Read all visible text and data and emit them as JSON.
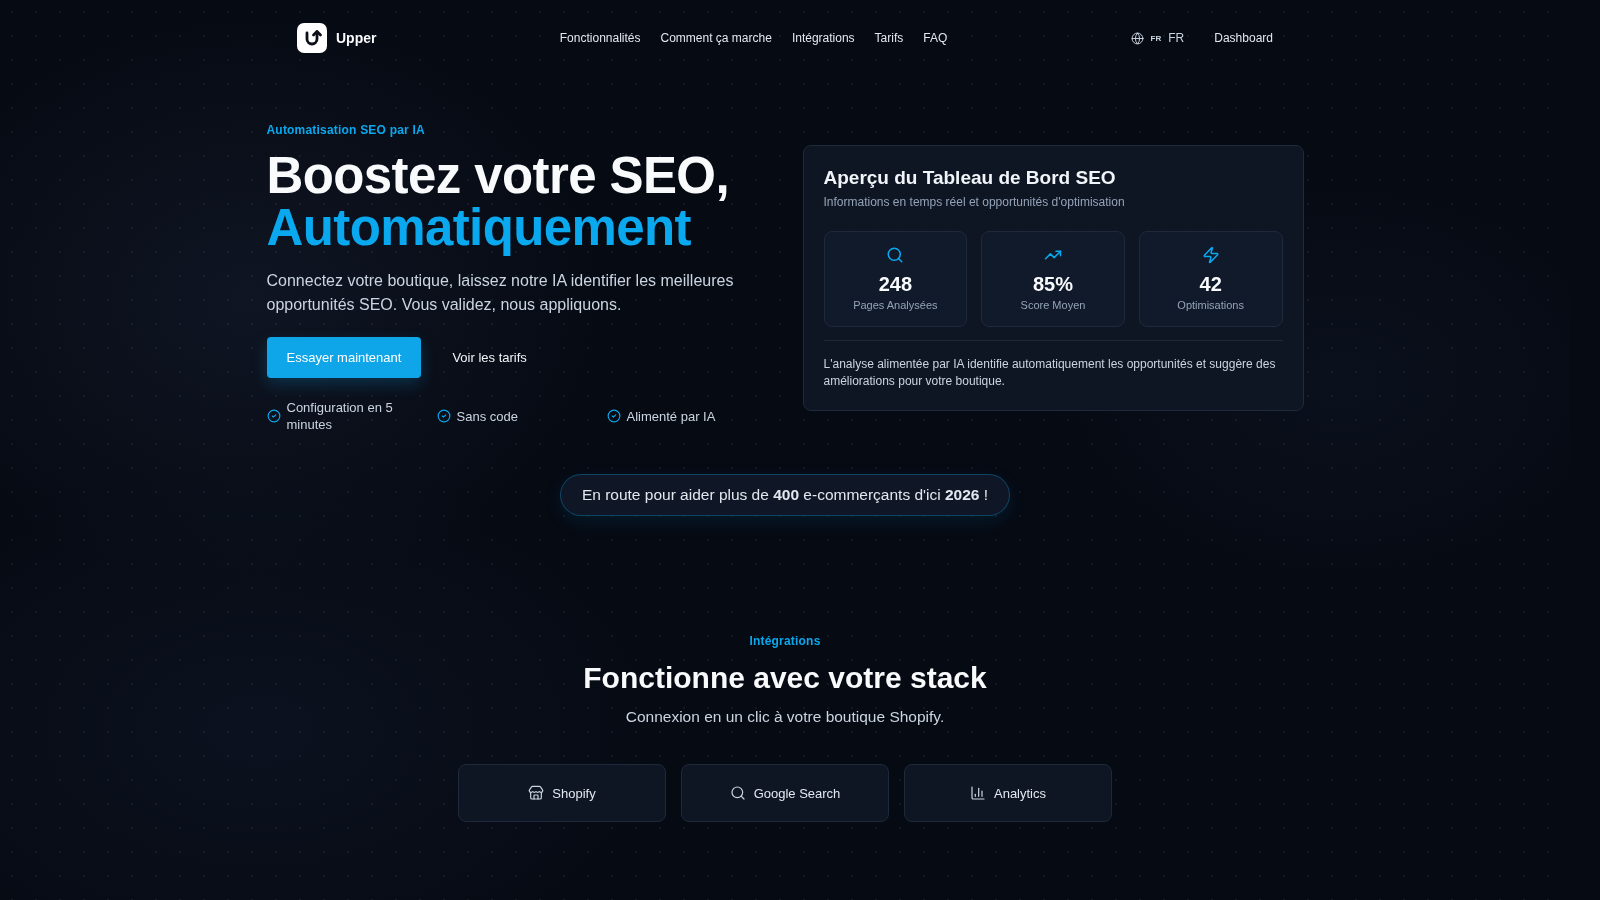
{
  "nav": {
    "brand": "Upper",
    "links": [
      "Fonctionnalités",
      "Comment ça marche",
      "Intégrations",
      "Tarifs",
      "FAQ"
    ],
    "language": {
      "flag": "FR",
      "code": "FR"
    },
    "dashboard": "Dashboard"
  },
  "hero": {
    "eyebrow": "Automatisation SEO par IA",
    "title": "Boostez votre SEO,",
    "title_accent": "Automatiquement",
    "description": "Connectez votre boutique, laissez notre IA identifier les meilleures opportunités SEO. Vous validez, nous appliquons.",
    "primary_button": "Essayer maintenant",
    "secondary_button": "Voir les tarifs",
    "features": [
      "Configuration en 5 minutes",
      "Sans code",
      "Alimenté par IA"
    ]
  },
  "dashboard_card": {
    "title": "Aperçu du Tableau de Bord SEO",
    "subtitle": "Informations en temps réel et opportunités d'optimisation",
    "stats": [
      {
        "value": "248",
        "label": "Pages Analysées"
      },
      {
        "value": "85%",
        "label": "Score Moyen"
      },
      {
        "value": "42",
        "label": "Optimisations"
      }
    ],
    "note": "L'analyse alimentée par IA identifie automatiquement les opportunités et suggère des améliorations pour votre boutique."
  },
  "banner": {
    "text": "En route pour aider plus de **400** e-commerçants d'ici **2026** !"
  },
  "integrations": {
    "eyebrow": "Intégrations",
    "title": "Fonctionne avec votre stack",
    "subtitle": "Connexion en un clic à votre boutique Shopify.",
    "items": [
      "Shopify",
      "Google Search",
      "Analytics"
    ]
  }
}
